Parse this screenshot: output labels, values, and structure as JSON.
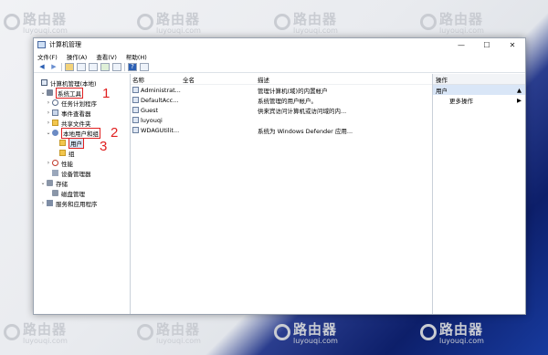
{
  "watermark": {
    "brand": "路由器",
    "site": "luyouqi.com"
  },
  "window": {
    "title": "计算机管理",
    "controls": {
      "minimize": "—",
      "maximize": "☐",
      "close": "✕"
    }
  },
  "menu": [
    "文件(F)",
    "操作(A)",
    "查看(V)",
    "帮助(H)"
  ],
  "tree": {
    "root": "计算机管理(本地)",
    "system_tools": "系统工具",
    "task_scheduler": "任务计划程序",
    "event_viewer": "事件查看器",
    "shared_folders": "共享文件夹",
    "local_users_groups": "本地用户和组",
    "users": "用户",
    "groups": "组",
    "performance": "性能",
    "device_manager": "设备管理器",
    "storage": "存储",
    "disk_management": "磁盘管理",
    "services_apps": "服务和应用程序"
  },
  "annotations": {
    "a1": "1",
    "a2": "2",
    "a3": "3"
  },
  "columns": {
    "name": "名称",
    "fullname": "全名",
    "description": "描述"
  },
  "users": [
    {
      "name": "Administrat...",
      "fullname": "",
      "description": "管理计算机(域)的内置帐户"
    },
    {
      "name": "DefaultAcc...",
      "fullname": "",
      "description": "系统管理的用户帐户。"
    },
    {
      "name": "Guest",
      "fullname": "",
      "description": "供来宾访问计算机或访问域的内..."
    },
    {
      "name": "luyouqi",
      "fullname": "",
      "description": ""
    },
    {
      "name": "WDAGUtilit...",
      "fullname": "",
      "description": "系统为 Windows Defender 应用..."
    }
  ],
  "actions": {
    "header": "操作",
    "selected": "用户",
    "more": "更多操作"
  },
  "colors": {
    "annotation": "#e02020",
    "selection": "#d9e6f7"
  }
}
